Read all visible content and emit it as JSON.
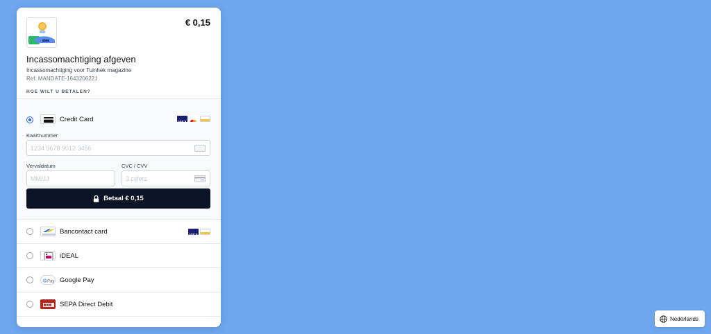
{
  "header": {
    "amount": "€ 0,15",
    "title": "Incassomachtiging afgeven",
    "description": "Incassomachtiging voor Tuinhek magazine",
    "reference": "Ref. MANDATE-1643206221",
    "how_to_pay": "HOE WILT U BETALEN?"
  },
  "credit_card": {
    "label": "Credit Card",
    "selected": true,
    "brands": [
      "visa",
      "mastercard",
      "cartes-bancaires"
    ],
    "card_number": {
      "label": "Kaartnummer",
      "placeholder": "1234 5678 9012 3456",
      "value": ""
    },
    "expiry": {
      "label": "Vervaldatum",
      "placeholder": "MM/JJ",
      "value": ""
    },
    "cvc": {
      "label": "CVC / CVV",
      "placeholder": "3 cijfers",
      "value": ""
    },
    "pay_button": "Betaal € 0,15"
  },
  "methods": [
    {
      "label": "Bancontact card",
      "icon": "bancontact-icon",
      "brands": [
        "visa",
        "cartes-bancaires"
      ]
    },
    {
      "label": "iDEAL",
      "icon": "ideal-icon"
    },
    {
      "label": "Google Pay",
      "icon": "google-pay-icon"
    },
    {
      "label": "SEPA Direct Debit",
      "icon": "sepa-icon"
    }
  ],
  "language": {
    "label": "Nederlands",
    "icon": "globe-icon"
  },
  "colors": {
    "background": "#6fa6ee",
    "button": "#0b1426",
    "radio_selected": "#2563eb"
  }
}
